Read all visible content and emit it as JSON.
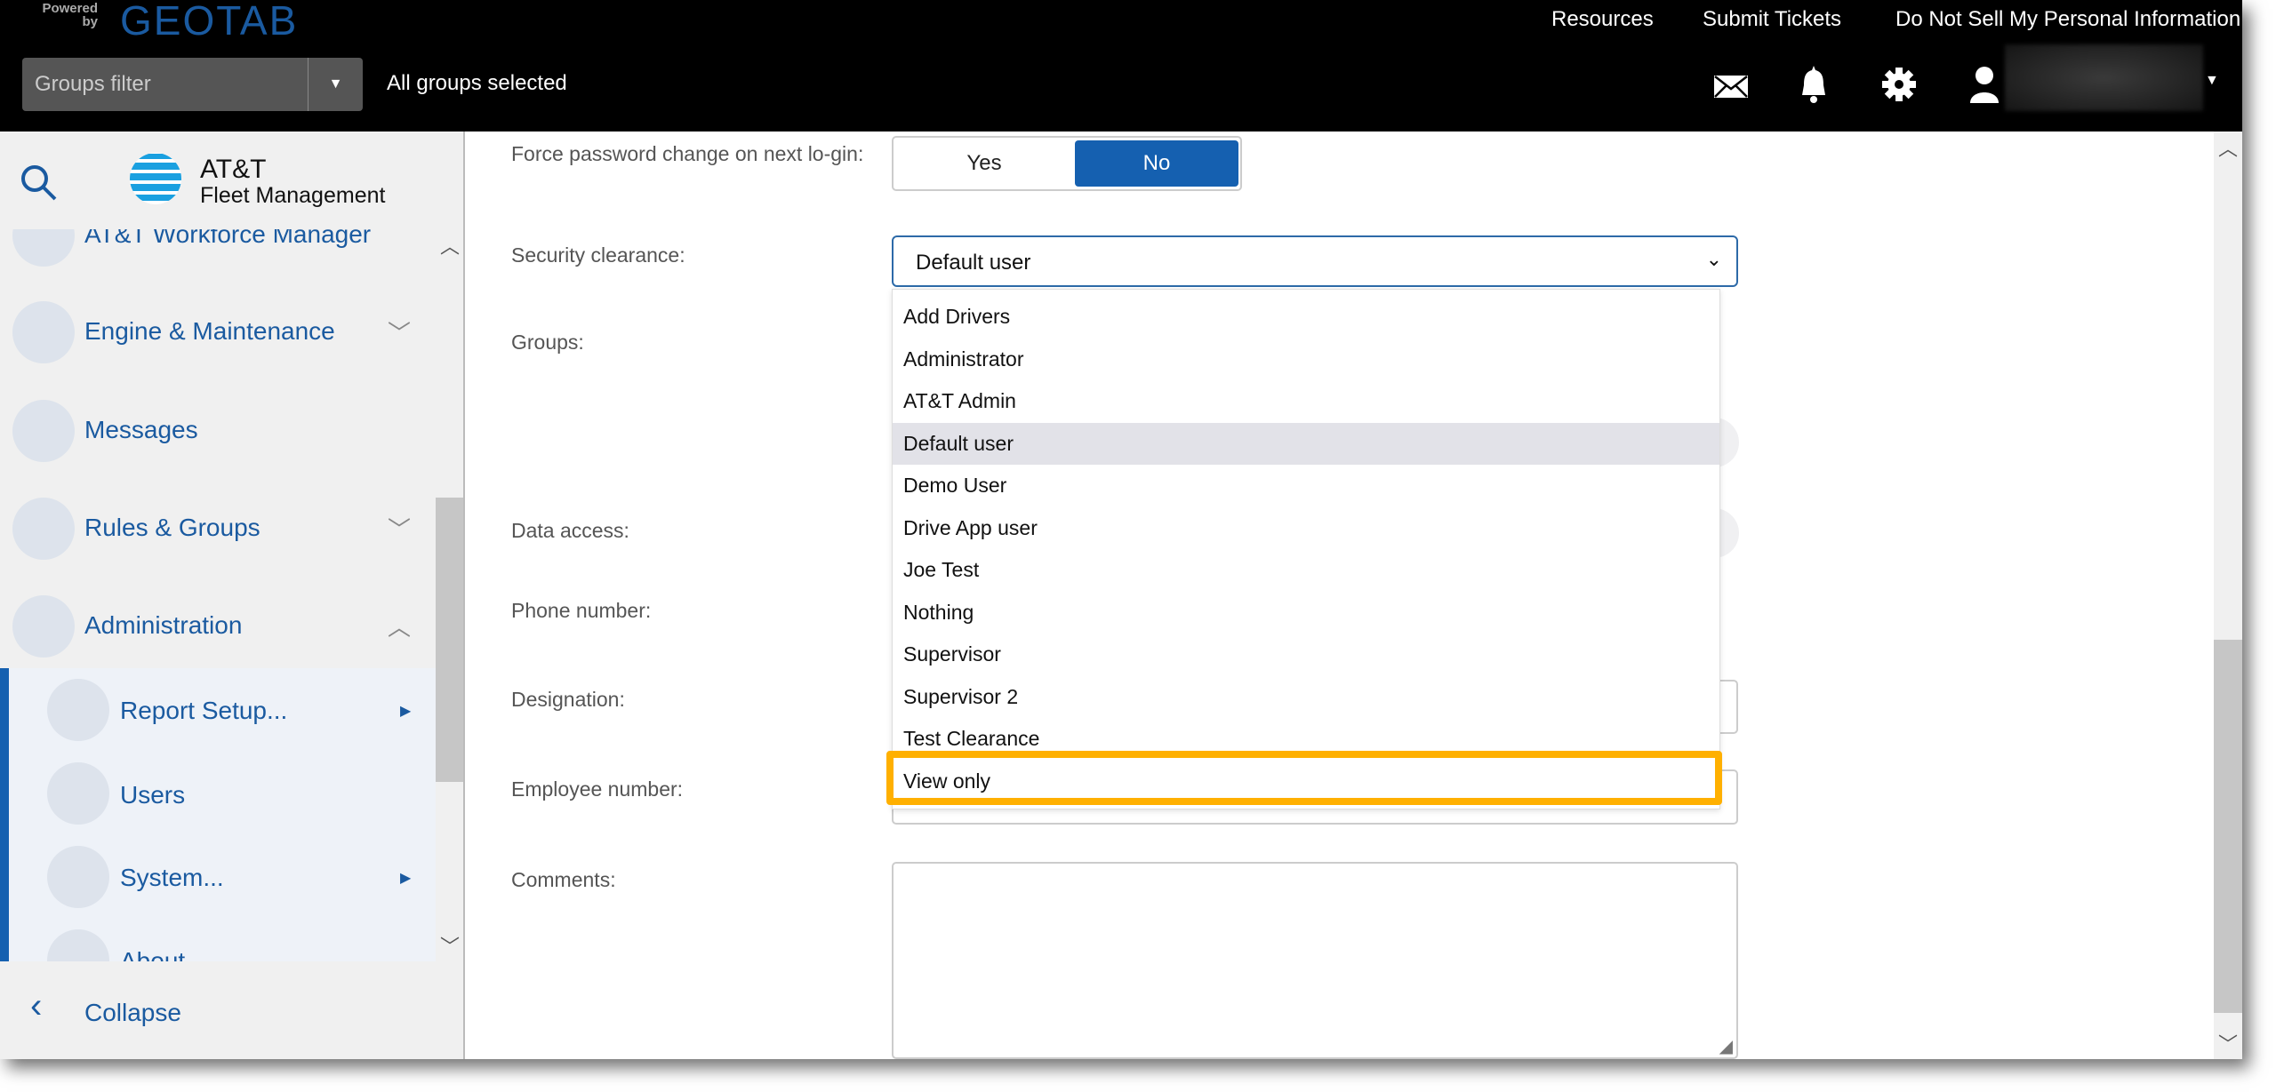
{
  "header": {
    "powered_by": "Powered by",
    "brand": "GEOTAB",
    "links": [
      "Resources",
      "Submit Tickets",
      "Do Not Sell My Personal Information"
    ],
    "groups_filter_placeholder": "Groups filter",
    "groups_status": "All groups selected",
    "icons": [
      "mail-icon",
      "bell-icon",
      "gear-icon",
      "user-icon"
    ]
  },
  "sidebar": {
    "logo_line1": "AT&T",
    "logo_line2": "Fleet Management",
    "items": [
      {
        "label": "AT&T Workforce Manager"
      },
      {
        "label": "Engine & Maintenance"
      },
      {
        "label": "Messages"
      },
      {
        "label": "Rules & Groups"
      },
      {
        "label": "Administration"
      }
    ],
    "subitems": [
      {
        "label": "Report Setup..."
      },
      {
        "label": "Users"
      },
      {
        "label": "System..."
      },
      {
        "label": "About"
      }
    ],
    "collapse": "Collapse",
    "accent": "#1a5aa0"
  },
  "form": {
    "force_password_label": "Force password change on next lo-gin:",
    "yes": "Yes",
    "no": "No",
    "selected_toggle": "No",
    "security_label": "Security clearance:",
    "security_value": "Default user",
    "groups_label": "Groups:",
    "data_access_label": "Data access:",
    "phone_label": "Phone number:",
    "designation_label": "Designation:",
    "employee_label": "Employee number:",
    "comments_label": "Comments:"
  },
  "dropdown": {
    "options": [
      "Add Drivers",
      "Administrator",
      "AT&T Admin",
      "Default user",
      "Demo User",
      "Drive App user",
      "Joe Test",
      "Nothing",
      "Supervisor",
      "Supervisor 2",
      "Test Clearance",
      "View only"
    ],
    "selected": "Default user",
    "highlighted": "View only",
    "highlight_color": "#ffb000"
  }
}
